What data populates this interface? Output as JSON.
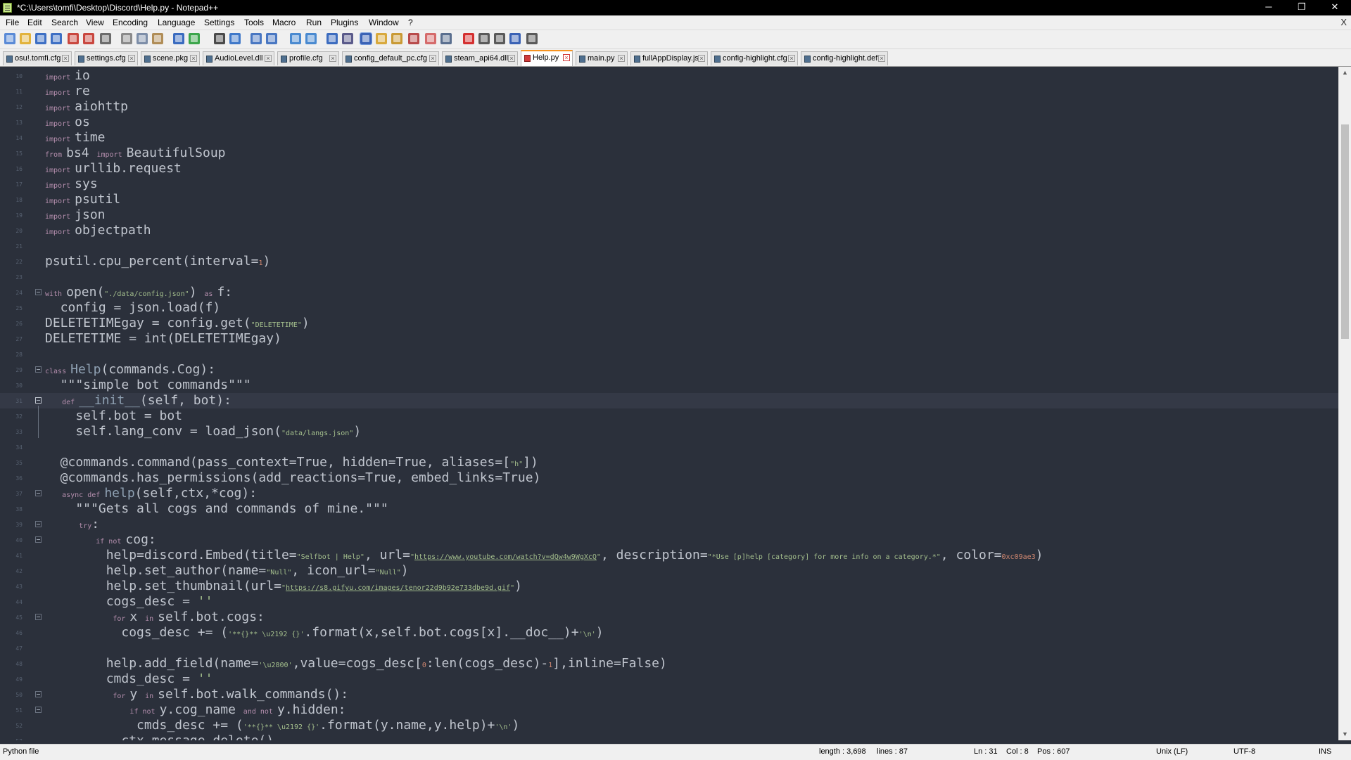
{
  "window": {
    "title": "*C:\\Users\\tomfi\\Desktop\\Discord\\Help.py - Notepad++",
    "minimize_glyph": "─",
    "restore_glyph": "❐",
    "close_glyph": "✕"
  },
  "menu": {
    "items": [
      "File",
      "Edit",
      "Search",
      "View",
      "Encoding",
      "Language",
      "Settings",
      "Tools",
      "Macro",
      "Run",
      "Plugins",
      "Window",
      "?"
    ],
    "close_glyph": "X"
  },
  "toolbar": {
    "icons": [
      "new-file-icon",
      "open-file-icon",
      "save-icon",
      "save-all-icon",
      "close-icon",
      "close-all-icon",
      "print-icon",
      "cut-icon",
      "copy-icon",
      "paste-icon",
      "undo-icon",
      "redo-icon",
      "find-icon",
      "replace-icon",
      "zoom-in-icon",
      "zoom-out-icon",
      "sync-vertical-icon",
      "sync-horizontal-icon",
      "word-wrap-icon",
      "show-all-chars-icon",
      "indent-guide-icon",
      "language-icon",
      "document-map-icon",
      "function-list-icon",
      "folder-workspace-icon",
      "monitoring-icon",
      "record-macro-icon",
      "stop-record-icon",
      "play-macro-icon",
      "run-macro-multiple-icon",
      "save-macro-icon"
    ]
  },
  "tabs": [
    {
      "label": "osu!.tomfi.cfg",
      "active": false
    },
    {
      "label": "settings.cfg",
      "active": false
    },
    {
      "label": "scene.pkg",
      "active": false
    },
    {
      "label": "AudioLevel.dll",
      "active": false
    },
    {
      "label": "profile.cfg",
      "active": false
    },
    {
      "label": "config_default_pc.cfg",
      "active": false
    },
    {
      "label": "steam_api64.dll",
      "active": false
    },
    {
      "label": "Help.py",
      "active": true
    },
    {
      "label": "main.py",
      "active": false
    },
    {
      "label": "fullAppDisplay.js",
      "active": false
    },
    {
      "label": "config-highlight.cfg",
      "active": false
    },
    {
      "label": "config-highlight.def",
      "active": false
    }
  ],
  "tab_close_glyph": "×",
  "scrollbar": {
    "up_glyph": "▲",
    "down_glyph": "▼"
  },
  "editor": {
    "current_line": 31,
    "lines": [
      {
        "n": "10",
        "fold": "",
        "tokens": [
          {
            "t": "import ",
            "c": "kw sm"
          },
          {
            "t": "io",
            "c": ""
          }
        ]
      },
      {
        "n": "11",
        "fold": "",
        "tokens": [
          {
            "t": "import ",
            "c": "kw sm"
          },
          {
            "t": "re",
            "c": ""
          }
        ]
      },
      {
        "n": "12",
        "fold": "",
        "tokens": [
          {
            "t": "import ",
            "c": "kw sm"
          },
          {
            "t": "aiohttp",
            "c": ""
          }
        ]
      },
      {
        "n": "13",
        "fold": "",
        "tokens": [
          {
            "t": "import ",
            "c": "kw sm"
          },
          {
            "t": "os",
            "c": ""
          }
        ]
      },
      {
        "n": "14",
        "fold": "",
        "tokens": [
          {
            "t": "import ",
            "c": "kw sm"
          },
          {
            "t": "time",
            "c": ""
          }
        ]
      },
      {
        "n": "15",
        "fold": "",
        "tokens": [
          {
            "t": "from ",
            "c": "kw sm"
          },
          {
            "t": "bs4 ",
            "c": ""
          },
          {
            "t": "import ",
            "c": "kw sm"
          },
          {
            "t": "BeautifulSoup",
            "c": ""
          }
        ]
      },
      {
        "n": "16",
        "fold": "",
        "tokens": [
          {
            "t": "import ",
            "c": "kw sm"
          },
          {
            "t": "urllib.request",
            "c": ""
          }
        ]
      },
      {
        "n": "17",
        "fold": "",
        "tokens": [
          {
            "t": "import ",
            "c": "kw sm"
          },
          {
            "t": "sys",
            "c": ""
          }
        ]
      },
      {
        "n": "18",
        "fold": "",
        "tokens": [
          {
            "t": "import ",
            "c": "kw sm"
          },
          {
            "t": "psutil",
            "c": ""
          }
        ]
      },
      {
        "n": "19",
        "fold": "",
        "tokens": [
          {
            "t": "import ",
            "c": "kw sm"
          },
          {
            "t": "json",
            "c": ""
          }
        ]
      },
      {
        "n": "20",
        "fold": "",
        "tokens": [
          {
            "t": "import ",
            "c": "kw sm"
          },
          {
            "t": "objectpath",
            "c": ""
          }
        ]
      },
      {
        "n": "21",
        "fold": "",
        "tokens": []
      },
      {
        "n": "22",
        "fold": "",
        "tokens": [
          {
            "t": "psutil.cpu_percent(interval=",
            "c": ""
          },
          {
            "t": "1",
            "c": "num sm"
          },
          {
            "t": ")",
            "c": ""
          }
        ]
      },
      {
        "n": "23",
        "fold": "",
        "tokens": []
      },
      {
        "n": "24",
        "fold": "box",
        "tokens": [
          {
            "t": "with ",
            "c": "kw sm"
          },
          {
            "t": "open(",
            "c": ""
          },
          {
            "t": "\"./data/config.json\"",
            "c": "str sm"
          },
          {
            "t": ") ",
            "c": ""
          },
          {
            "t": "as ",
            "c": "kw sm"
          },
          {
            "t": "f:",
            "c": ""
          }
        ]
      },
      {
        "n": "25",
        "fold": "",
        "tokens": [
          {
            "t": "  config = json.load(f)",
            "c": ""
          }
        ]
      },
      {
        "n": "26",
        "fold": "",
        "tokens": [
          {
            "t": "DELETETIMEgay = config.get(",
            "c": ""
          },
          {
            "t": "\"DELETETIME\"",
            "c": "str sm"
          },
          {
            "t": ")",
            "c": ""
          }
        ]
      },
      {
        "n": "27",
        "fold": "",
        "tokens": [
          {
            "t": "DELETETIME = int(DELETETIMEgay)",
            "c": ""
          }
        ]
      },
      {
        "n": "28",
        "fold": "",
        "tokens": []
      },
      {
        "n": "29",
        "fold": "box",
        "tokens": [
          {
            "t": "class ",
            "c": "kw sm"
          },
          {
            "t": "Help",
            "c": "cls"
          },
          {
            "t": "(commands.Cog):",
            "c": ""
          }
        ]
      },
      {
        "n": "30",
        "fold": "",
        "tokens": [
          {
            "t": "  \"\"\"simple bot commands\"\"\"",
            "c": ""
          }
        ]
      },
      {
        "n": "31",
        "fold": "box-hl",
        "tokens": [
          {
            "t": "    ",
            "c": "sm"
          },
          {
            "t": "def ",
            "c": "kw sm"
          },
          {
            "t": "__init__",
            "c": "cls"
          },
          {
            "t": "(self, bot):",
            "c": ""
          }
        ]
      },
      {
        "n": "32",
        "fold": "",
        "tokens": [
          {
            "t": "    self.bot = bot",
            "c": ""
          }
        ]
      },
      {
        "n": "33",
        "fold": "",
        "tokens": [
          {
            "t": "    self.lang_conv = load_json(",
            "c": ""
          },
          {
            "t": "\"data/langs.json\"",
            "c": "str sm"
          },
          {
            "t": ")",
            "c": ""
          }
        ]
      },
      {
        "n": "34",
        "fold": "",
        "tokens": []
      },
      {
        "n": "35",
        "fold": "",
        "tokens": [
          {
            "t": "  @commands.command(pass_context=True, hidden=True, aliases=[",
            "c": ""
          },
          {
            "t": "\"h\"",
            "c": "str sm"
          },
          {
            "t": "])",
            "c": ""
          }
        ]
      },
      {
        "n": "36",
        "fold": "",
        "tokens": [
          {
            "t": "  @commands.has_permissions(add_reactions=True, embed_links=True)",
            "c": ""
          }
        ]
      },
      {
        "n": "37",
        "fold": "box",
        "tokens": [
          {
            "t": "    ",
            "c": "sm"
          },
          {
            "t": "async def ",
            "c": "kw sm"
          },
          {
            "t": "help",
            "c": "cls"
          },
          {
            "t": "(self,ctx,*cog):",
            "c": ""
          }
        ]
      },
      {
        "n": "38",
        "fold": "",
        "tokens": [
          {
            "t": "    \"\"\"Gets all cogs and commands of mine.\"\"\"",
            "c": ""
          }
        ]
      },
      {
        "n": "39",
        "fold": "box",
        "tokens": [
          {
            "t": "        ",
            "c": "sm"
          },
          {
            "t": "try",
            "c": "kw sm"
          },
          {
            "t": ":",
            "c": ""
          }
        ]
      },
      {
        "n": "40",
        "fold": "box",
        "tokens": [
          {
            "t": "            ",
            "c": "sm"
          },
          {
            "t": "if not ",
            "c": "kw sm"
          },
          {
            "t": "cog:",
            "c": ""
          }
        ]
      },
      {
        "n": "41",
        "fold": "",
        "tokens": [
          {
            "t": "        help=discord.Embed(title=",
            "c": ""
          },
          {
            "t": "\"Selfbot | Help\"",
            "c": "str sm"
          },
          {
            "t": ", url=",
            "c": ""
          },
          {
            "t": "\"",
            "c": "str sm"
          },
          {
            "t": "https://www.youtube.com/watch?v=dQw4w9WgXcQ",
            "c": "url sm"
          },
          {
            "t": "\"",
            "c": "str sm"
          },
          {
            "t": ", description=",
            "c": ""
          },
          {
            "t": "\"*Use [p]help [category] for more info on a category.*\"",
            "c": "str sm"
          },
          {
            "t": ", color=",
            "c": ""
          },
          {
            "t": "0xc09ae3",
            "c": "num sm"
          },
          {
            "t": ")",
            "c": ""
          }
        ]
      },
      {
        "n": "42",
        "fold": "",
        "tokens": [
          {
            "t": "        help.set_author(name=",
            "c": ""
          },
          {
            "t": "\"Null\"",
            "c": "str sm"
          },
          {
            "t": ", icon_url=",
            "c": ""
          },
          {
            "t": "\"Null\"",
            "c": "str sm"
          },
          {
            "t": ")",
            "c": ""
          }
        ]
      },
      {
        "n": "43",
        "fold": "",
        "tokens": [
          {
            "t": "        help.set_thumbnail(url=",
            "c": ""
          },
          {
            "t": "\"",
            "c": "str sm"
          },
          {
            "t": "https://s8.gifyu.com/images/tenor22d9b92e733dbe9d.gif",
            "c": "url sm"
          },
          {
            "t": "\"",
            "c": "str sm"
          },
          {
            "t": ")",
            "c": ""
          }
        ]
      },
      {
        "n": "44",
        "fold": "",
        "tokens": [
          {
            "t": "        cogs_desc = ",
            "c": ""
          },
          {
            "t": "''",
            "c": "str"
          }
        ]
      },
      {
        "n": "45",
        "fold": "box",
        "tokens": [
          {
            "t": "                ",
            "c": "sm"
          },
          {
            "t": "for ",
            "c": "kw sm"
          },
          {
            "t": "x ",
            "c": ""
          },
          {
            "t": "in ",
            "c": "kw sm"
          },
          {
            "t": "self.bot.cogs:",
            "c": ""
          }
        ]
      },
      {
        "n": "46",
        "fold": "",
        "tokens": [
          {
            "t": "          cogs_desc += (",
            "c": ""
          },
          {
            "t": "'**{}** \\u2192 {}'",
            "c": "str sm"
          },
          {
            "t": ".format(x,self.bot.cogs[x].__doc__)+",
            "c": ""
          },
          {
            "t": "'\\n'",
            "c": "str sm"
          },
          {
            "t": ")",
            "c": ""
          }
        ]
      },
      {
        "n": "47",
        "fold": "",
        "tokens": []
      },
      {
        "n": "48",
        "fold": "",
        "tokens": [
          {
            "t": "        help.add_field(name=",
            "c": ""
          },
          {
            "t": "'\\u2800'",
            "c": "str sm"
          },
          {
            "t": ",value=cogs_desc[",
            "c": ""
          },
          {
            "t": "0",
            "c": "num sm"
          },
          {
            "t": ":len(cogs_desc)-",
            "c": ""
          },
          {
            "t": "1",
            "c": "num sm"
          },
          {
            "t": "],inline=False)",
            "c": ""
          }
        ]
      },
      {
        "n": "49",
        "fold": "",
        "tokens": [
          {
            "t": "        cmds_desc = ",
            "c": ""
          },
          {
            "t": "''",
            "c": "str"
          }
        ]
      },
      {
        "n": "50",
        "fold": "box",
        "tokens": [
          {
            "t": "                ",
            "c": "sm"
          },
          {
            "t": "for ",
            "c": "kw sm"
          },
          {
            "t": "y ",
            "c": ""
          },
          {
            "t": "in ",
            "c": "kw sm"
          },
          {
            "t": "self.bot.walk_commands():",
            "c": ""
          }
        ]
      },
      {
        "n": "51",
        "fold": "box",
        "tokens": [
          {
            "t": "                    ",
            "c": "sm"
          },
          {
            "t": "if not ",
            "c": "kw sm"
          },
          {
            "t": "y.cog_name ",
            "c": ""
          },
          {
            "t": "and not ",
            "c": "kw sm"
          },
          {
            "t": "y.hidden:",
            "c": ""
          }
        ]
      },
      {
        "n": "52",
        "fold": "",
        "tokens": [
          {
            "t": "            cmds_desc += (",
            "c": ""
          },
          {
            "t": "'**{}** \\u2192 {}'",
            "c": "str sm"
          },
          {
            "t": ".format(y.name,y.help)+",
            "c": ""
          },
          {
            "t": "'\\n'",
            "c": "str sm"
          },
          {
            "t": ")",
            "c": ""
          }
        ]
      },
      {
        "n": "53",
        "fold": "",
        "tokens": [
          {
            "t": "          ctx.message.delete()",
            "c": ""
          }
        ]
      }
    ]
  },
  "status": {
    "language": "Python file",
    "length": "length : 3,698",
    "lines": "lines : 87",
    "ln": "Ln : 31",
    "col": "Col : 8",
    "pos": "Pos : 607",
    "eol": "Unix (LF)",
    "encoding": "UTF-8",
    "mode": "INS"
  },
  "colors": {
    "editor_bg": "#2b303b",
    "keyword": "#b48ead",
    "string": "#a3be8c",
    "number": "#d08770",
    "class_name": "#8fa1b3",
    "text": "#c0c5ce",
    "active_tab_accent": "#f79421"
  }
}
